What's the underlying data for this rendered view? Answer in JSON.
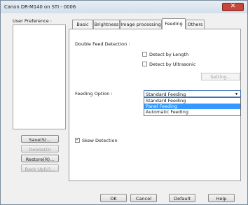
{
  "window": {
    "title": "Canon DR-M140 on STI - 0006",
    "close_glyph": "✕"
  },
  "sidebar": {
    "user_preference_label": "User Preference :",
    "buttons": {
      "save": "Save(S)...",
      "delete": "Delete(D)",
      "restore": "Restore(R)...",
      "backup": "Back Up(U)..."
    }
  },
  "tabs": [
    "Basic",
    "Brightness",
    "Image processing",
    "Feeding",
    "Others"
  ],
  "active_tab": "Feeding",
  "feeding": {
    "double_feed_label": "Double Feed Detection :",
    "detect_by_length": "Detect by Length",
    "detect_by_ultrasonic": "Detect by Ultrasonic",
    "setting_button": "Setting...",
    "feeding_option_label": "Feeding Option :",
    "feeding_option_value": "Standard Feeding",
    "dropdown_options": [
      "Standard Feeding",
      "Panel Feeding",
      "Automatic Feeding"
    ],
    "highlighted_option": "Panel Feeding",
    "skew_detection": "Skew Detection"
  },
  "footer": {
    "ok": "OK",
    "cancel": "Cancel",
    "default": "Default",
    "help": "Help"
  },
  "colors": {
    "accent": "#3399ff",
    "close": "#c8473a"
  }
}
